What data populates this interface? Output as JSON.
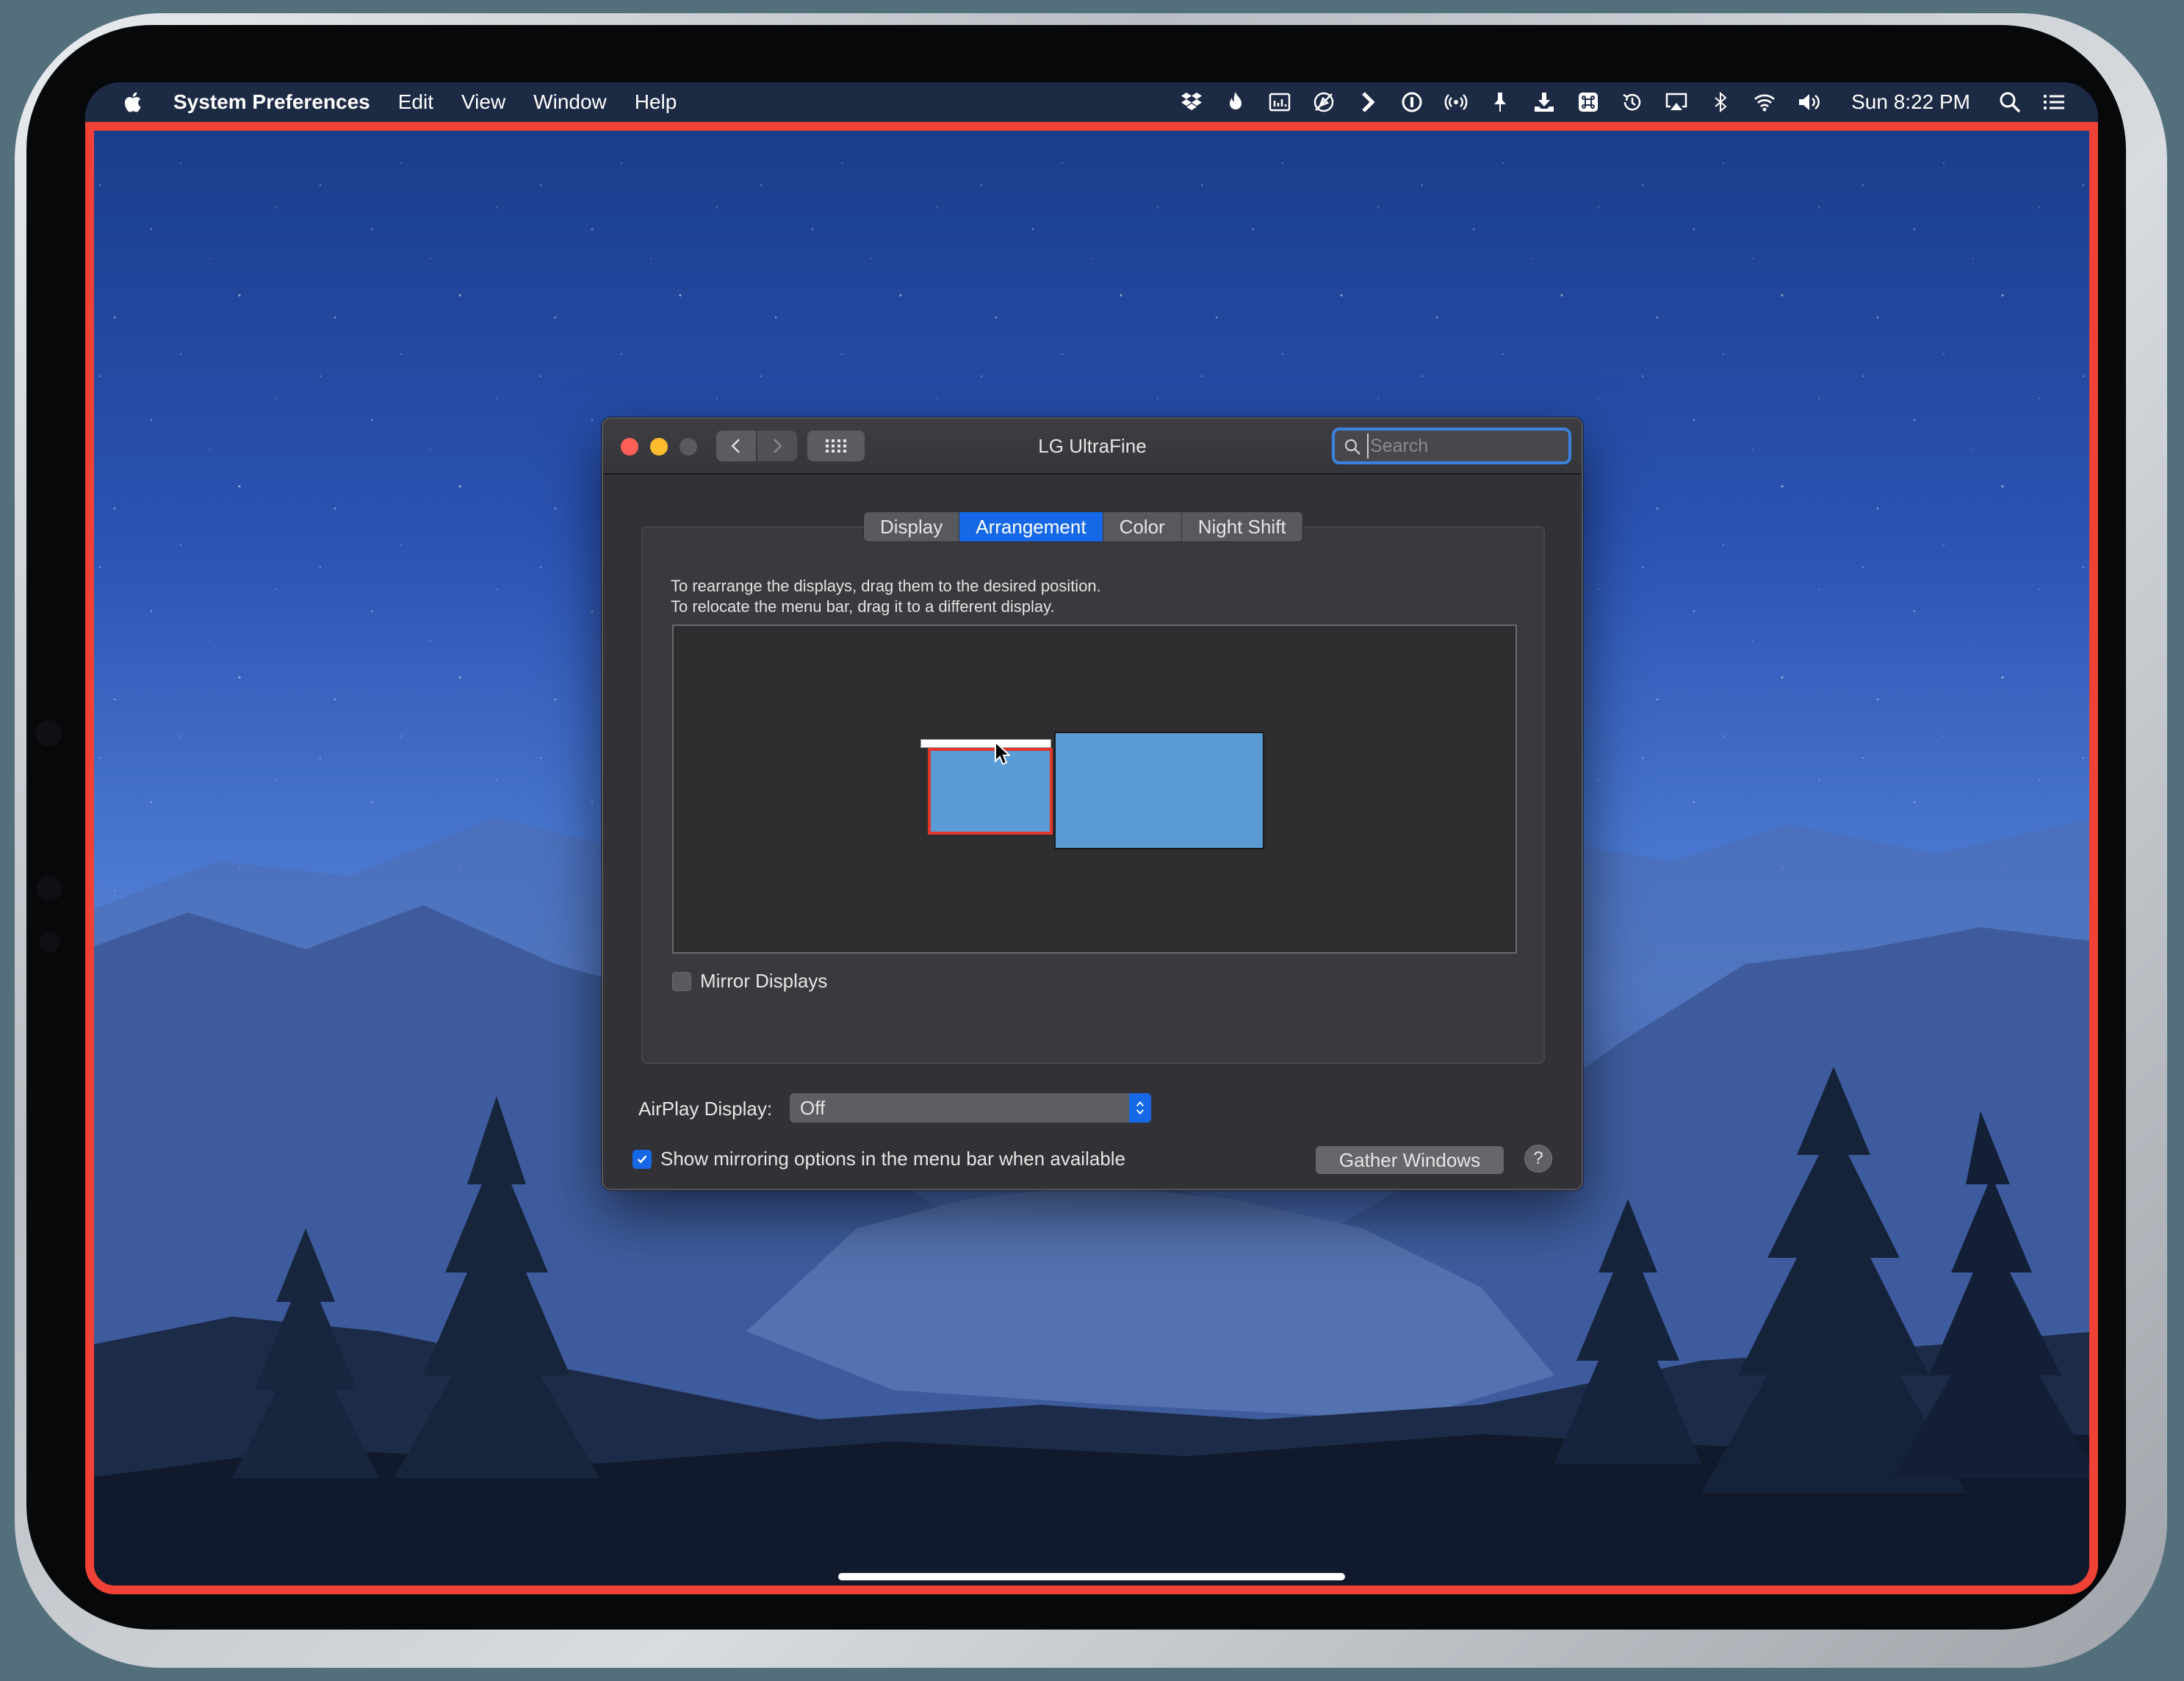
{
  "menubar": {
    "app_name": "System Preferences",
    "menus": [
      "Edit",
      "View",
      "Window",
      "Help"
    ],
    "clock": "Sun 8:22 PM",
    "status_icons": [
      "dropbox-icon",
      "flame-icon",
      "istat-icon",
      "compass-slash-icon",
      "chevron-right-icon",
      "onepassword-icon",
      "broadcast-icon",
      "pin-icon",
      "download-icon",
      "command-icon",
      "time-machine-icon",
      "airplay-icon",
      "bluetooth-icon",
      "wifi-icon",
      "volume-icon",
      "spotlight-icon",
      "notification-center-icon"
    ]
  },
  "window": {
    "title": "LG UltraFine",
    "search_placeholder": "Search",
    "tabs": [
      {
        "label": "Display",
        "active": false
      },
      {
        "label": "Arrangement",
        "active": true
      },
      {
        "label": "Color",
        "active": false
      },
      {
        "label": "Night Shift",
        "active": false
      }
    ],
    "instructions": [
      "To rearrange the displays, drag them to the desired position.",
      "To relocate the menu bar, drag it to a different display."
    ],
    "mirror_displays_label": "Mirror Displays",
    "mirror_displays_checked": false,
    "airplay_label": "AirPlay Display:",
    "airplay_value": "Off",
    "show_mirroring_label": "Show mirroring options in the menu bar when available",
    "show_mirroring_checked": true,
    "gather_windows_label": "Gather Windows",
    "help_label": "?"
  },
  "colors": {
    "accent": "#1668e6",
    "display_blue": "#5a9bd5",
    "selection_red": "#e0362c",
    "frame_outline": "#ef4136"
  }
}
